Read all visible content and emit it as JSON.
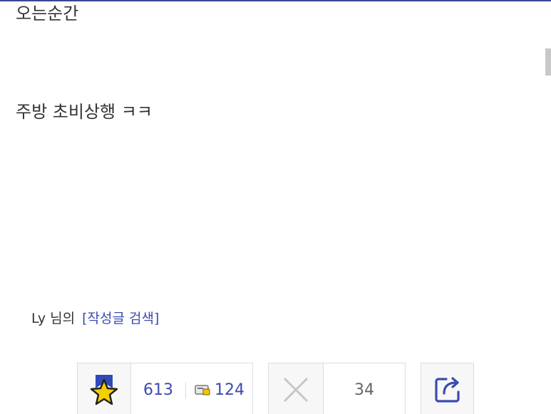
{
  "post": {
    "body_lines": [
      "오는순간",
      "주방 초비상행 ㅋㅋ"
    ]
  },
  "author": {
    "name_suffix": "Ly 님의",
    "search_link": "[작성글 검색]"
  },
  "recommend": {
    "count": "613",
    "fixed_count": "124"
  },
  "not_recommend": {
    "count": "34"
  },
  "colors": {
    "accent": "#3b4bb0",
    "star_fill": "#f5d000",
    "star_bg": "#2f49b6",
    "border": "#dddddd"
  },
  "icons": {
    "recommend": "star-icon",
    "fixed": "fix-badge-icon",
    "not_recommend": "x-icon",
    "share": "share-icon"
  }
}
